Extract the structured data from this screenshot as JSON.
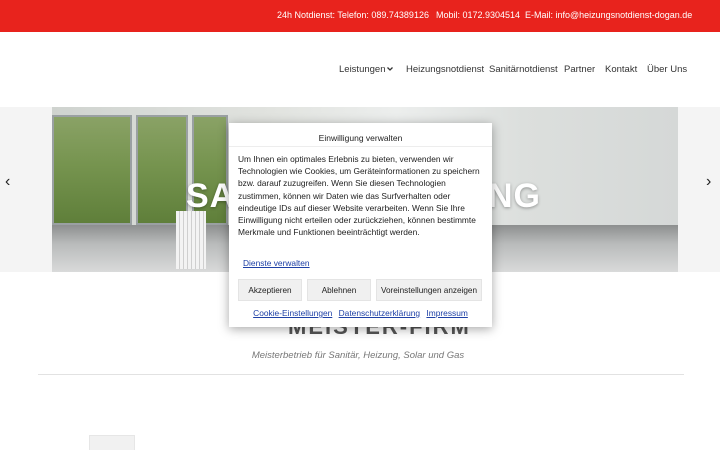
{
  "topbar": {
    "notdienst": "24h Notdienst: Telefon: 089.74389126",
    "mobil": "Mobil: 0172.9304514",
    "email": "E-Mail: info@heizungsnotdienst-dogan.de"
  },
  "nav": {
    "items": [
      {
        "label": "Leistungen"
      },
      {
        "label": "Heizungsnotdienst"
      },
      {
        "label": "Sanitärnotdienst"
      },
      {
        "label": "Partner"
      },
      {
        "label": "Kontakt"
      },
      {
        "label": "Über Uns"
      }
    ]
  },
  "hero": {
    "title_left": "SA",
    "title_right": "NG",
    "prev_arrow": "‹",
    "next_arrow": "›"
  },
  "page": {
    "heading": "MEISTER-FIRM",
    "tagline": "Meisterbetrieb für Sanitär, Heizung, Solar und Gas"
  },
  "cookie": {
    "title": "Einwilligung verwalten",
    "text": "Um Ihnen ein optimales Erlebnis zu bieten, verwenden wir Technologien wie Cookies, um Geräteinformationen zu speichern bzw. darauf zuzugreifen. Wenn Sie diesen Technologien zustimmen, können wir Daten wie das Surfverhalten oder eindeutige IDs auf dieser Website verarbeiten. Wenn Sie Ihre Einwilligung nicht erteilen oder zurückziehen, können bestimmte Merkmale und Funktionen beeinträchtigt werden.",
    "manage_link": "Dienste verwalten",
    "accept": "Akzeptieren",
    "reject": "Ablehnen",
    "preferences": "Voreinstellungen anzeigen",
    "links": {
      "settings": "Cookie-Einstellungen",
      "privacy": "Datenschutzerklärung",
      "imprint": "Impressum"
    }
  },
  "colors": {
    "topbar": "#e8231d",
    "link": "#1e40a6"
  }
}
